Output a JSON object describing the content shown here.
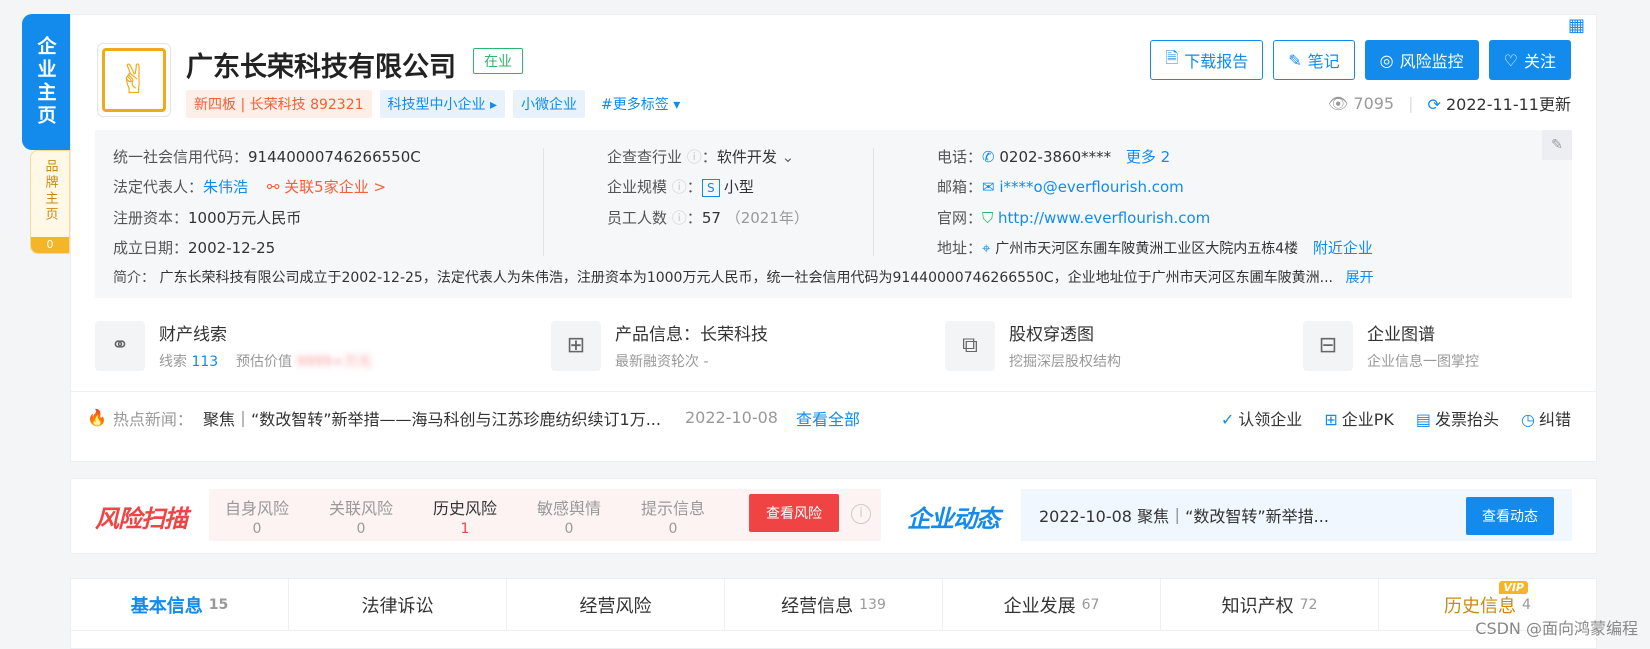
{
  "side": {
    "main_label": "企业主页",
    "brand_label": "品牌主页",
    "brand_count": "0"
  },
  "company": {
    "name": "广东长荣科技有限公司",
    "status": "在业",
    "tags": [
      "新四板 | 长荣科技 892321",
      "科技型中小企业",
      "小微企业",
      "#更多标签"
    ]
  },
  "actions": {
    "download": "下载报告",
    "note": "笔记",
    "monitor": "风险监控",
    "follow": "关注"
  },
  "meta": {
    "views": "7095",
    "updated": "2022-11-11更新"
  },
  "info": {
    "credit_code_label": "统一社会信用代码：",
    "credit_code": "91440000746266550C",
    "legal_rep_label": "法定代表人：",
    "legal_rep": "朱伟浩",
    "related": "关联5家企业 >",
    "capital_label": "注册资本：",
    "capital": "1000万元人民币",
    "founded_label": "成立日期：",
    "founded": "2002-12-25",
    "industry_label": "企查查行业",
    "industry": "软件开发",
    "scale_label": "企业规模",
    "scale_badge": "S",
    "scale": "小型",
    "staff_label": "员工人数",
    "staff": "57",
    "staff_year": "（2021年）",
    "phone_label": "电话：",
    "phone": "0202-3860****",
    "phone_more": "更多 2",
    "email_label": "邮箱：",
    "email": "i****o@everflourish.com",
    "website_label": "官网：",
    "website": "http://www.everflourish.com",
    "address_label": "地址：",
    "address": "广州市天河区东圃车陂黄洲工业区大院内五栋4楼",
    "nearby": "附近企业",
    "intro_label": "简介：",
    "intro": "广东长荣科技有限公司成立于2002-12-25，法定代表人为朱伟浩，注册资本为1000万元人民币，统一社会信用代码为91440000746266550C，企业地址位于广州市天河区东圃车陂黄洲...",
    "expand": "展开"
  },
  "features": [
    {
      "title": "财产线索",
      "sub1": "线索",
      "sub1_val": "113",
      "sub2": "预估价值",
      "sub2_val": "9999+万元"
    },
    {
      "title": "产品信息：长荣科技",
      "sub": "最新融资轮次 -"
    },
    {
      "title": "股权穿透图",
      "sub": "挖掘深层股权结构"
    },
    {
      "title": "企业图谱",
      "sub": "企业信息一图掌控"
    }
  ],
  "news": {
    "label": "热点新闻：",
    "text": "聚焦｜“数改智转”新举措——海马科创与江苏珍鹿纺织续订1万...",
    "date": "2022-10-08",
    "view_all": "查看全部",
    "actions": [
      "认领企业",
      "企业PK",
      "发票抬头",
      "纠错"
    ]
  },
  "risk": {
    "title": "风险扫描",
    "items": [
      {
        "label": "自身风险",
        "count": "0"
      },
      {
        "label": "关联风险",
        "count": "0"
      },
      {
        "label": "历史风险",
        "count": "1"
      },
      {
        "label": "敏感舆情",
        "count": "0"
      },
      {
        "label": "提示信息",
        "count": "0"
      }
    ],
    "button": "查看风险"
  },
  "dynamic": {
    "title": "企业动态",
    "text": "2022-10-08 聚焦｜“数改智转”新举措...",
    "button": "查看动态"
  },
  "tabs": [
    {
      "label": "基本信息",
      "count": "15"
    },
    {
      "label": "法律诉讼",
      "count": ""
    },
    {
      "label": "经营风险",
      "count": ""
    },
    {
      "label": "经营信息",
      "count": "139"
    },
    {
      "label": "企业发展",
      "count": "67"
    },
    {
      "label": "知识产权",
      "count": "72"
    },
    {
      "label": "历史信息",
      "count": "4"
    }
  ],
  "vip_badge": "VIP",
  "watermark": "CSDN @面向鸿蒙编程"
}
